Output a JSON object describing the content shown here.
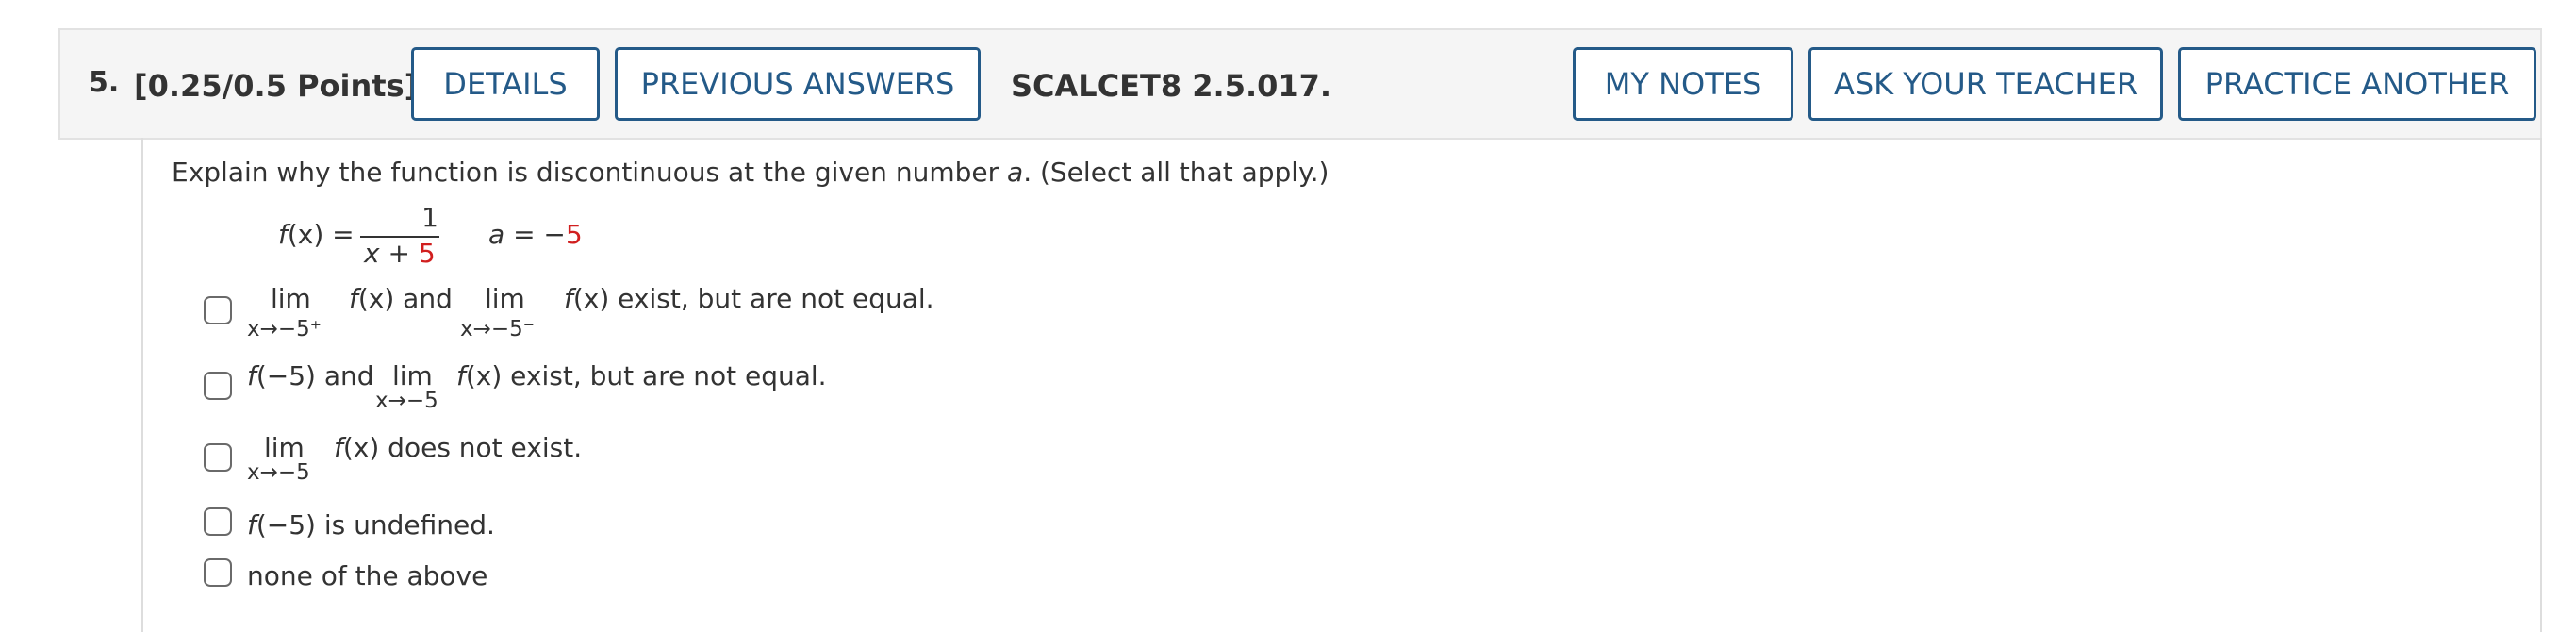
{
  "header": {
    "number": "5.",
    "points": "[0.25/0.5 Points]",
    "details_label": "DETAILS",
    "previous_answers_label": "PREVIOUS ANSWERS",
    "code": "SCALCET8 2.5.017.",
    "my_notes_label": "MY NOTES",
    "ask_teacher_label": "ASK YOUR TEACHER",
    "practice_another_label": "PRACTICE ANOTHER"
  },
  "question": {
    "prompt_before": "Explain why the function is discontinuous at the given number ",
    "prompt_var": "a",
    "prompt_after": ". (Select all that apply.)",
    "function": {
      "lhs_f": "f",
      "lhs_arg": "(x) =",
      "numerator": "1",
      "denom_x": "x",
      "denom_plus": " + ",
      "denom_num": "5",
      "a_var": "a",
      "a_eq": " = −",
      "a_value": "5"
    }
  },
  "options": {
    "o1": {
      "lim": "lim",
      "sub1": "x→−5⁺",
      "fx1_f": "f",
      "fx1_x": "(x)",
      "and": " and",
      "lim2": "lim",
      "sub2": "x→−5⁻",
      "fx2_f": "f",
      "fx2_x": "(x)",
      "tail": " exist, but are not equal.",
      "checked": false
    },
    "o2": {
      "f": "f",
      "arg": "(−5)",
      "and": " and",
      "lim": "lim",
      "sub": "x→−5",
      "fx_f": "f",
      "fx_x": "(x)",
      "tail": " exist, but are not equal.",
      "checked": false
    },
    "o3": {
      "lim": "lim",
      "sub": "x→−5",
      "fx_f": "f",
      "fx_x": "(x)",
      "tail": " does not exist.",
      "checked": false
    },
    "o4": {
      "f": "f",
      "arg": "(−5)",
      "tail": " is undefined.",
      "checked": false
    },
    "o5": {
      "label": "none of the above",
      "checked": false
    }
  },
  "colors": {
    "accent": "#245a88",
    "highlight_red": "#d11f1f",
    "header_bg": "#f5f5f5",
    "text": "#333333"
  }
}
